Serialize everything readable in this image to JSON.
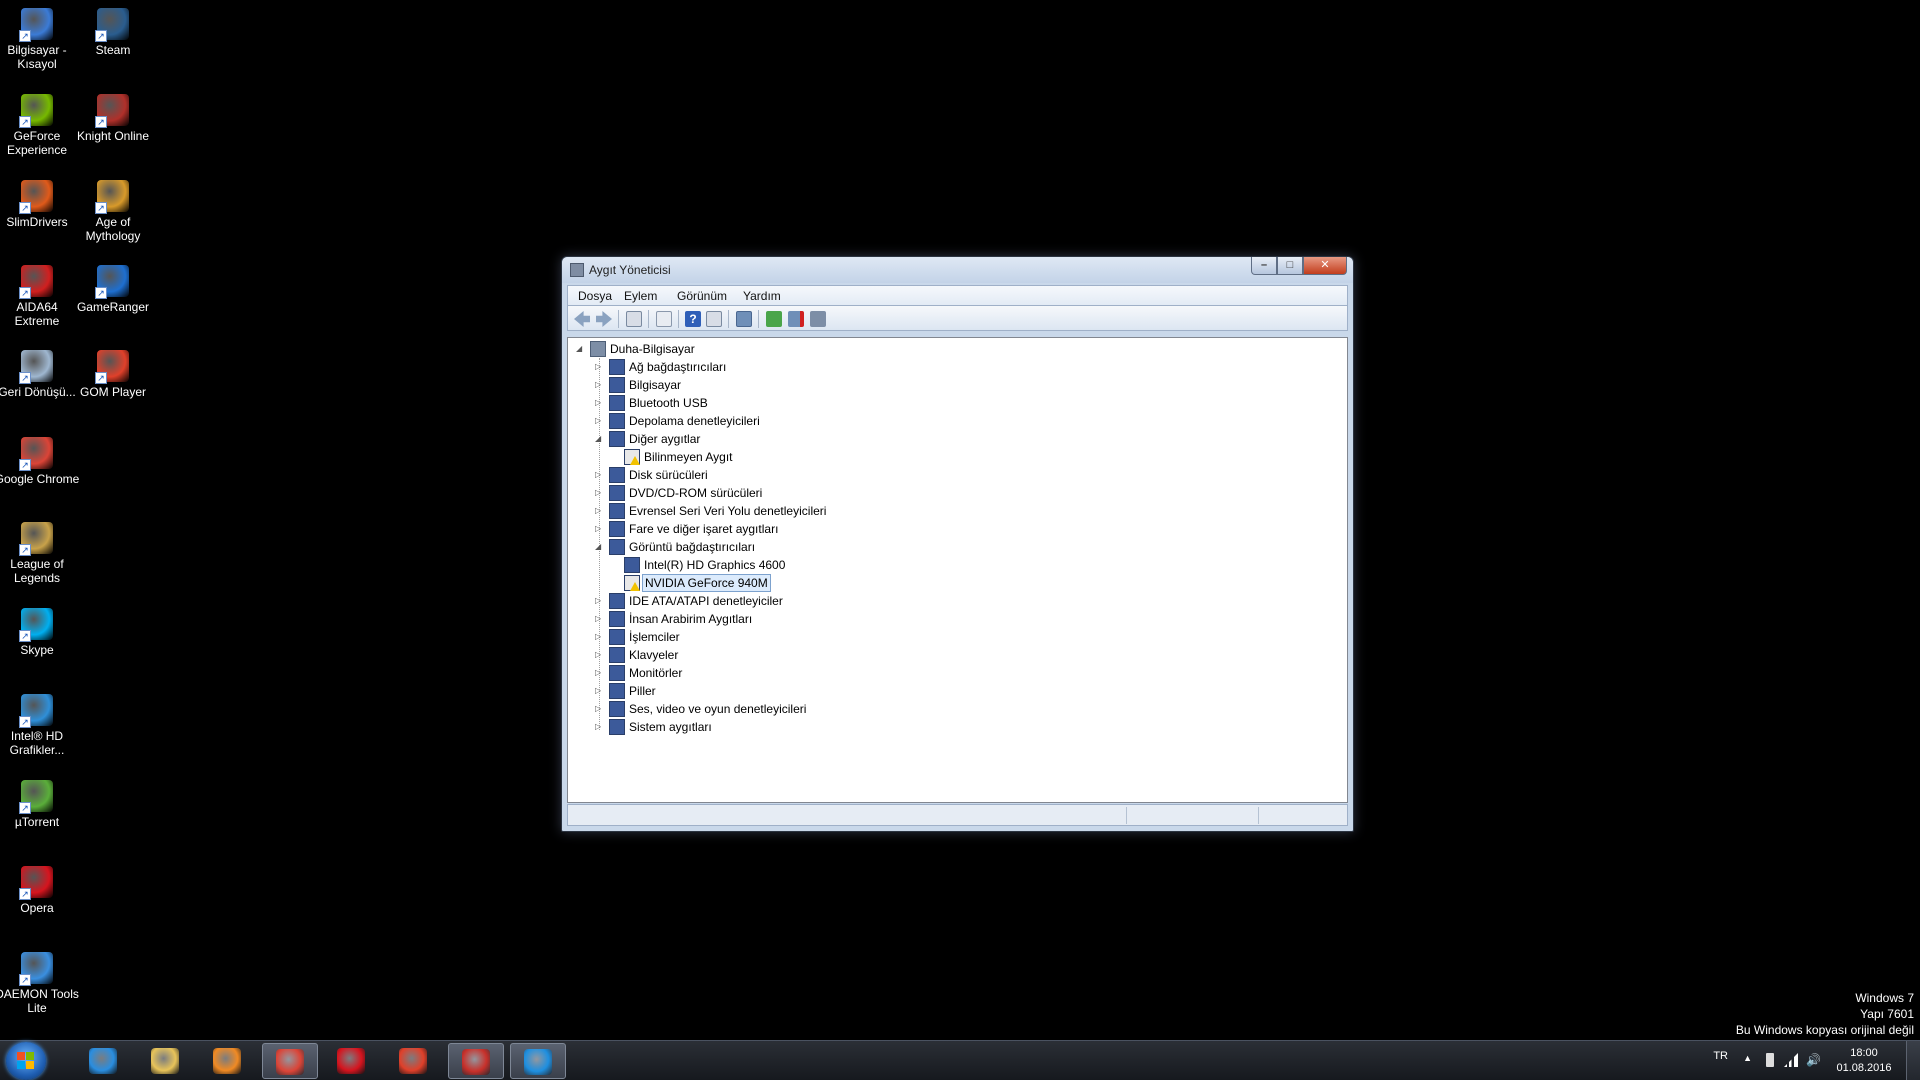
{
  "desktop_icons": [
    {
      "label": "Bilgisayar - Kısayol",
      "icon": "computer-icon",
      "color": "#3b7bd6"
    },
    {
      "label": "GeForce Experience",
      "icon": "geforce-icon",
      "color": "#76b900"
    },
    {
      "label": "SlimDrivers",
      "icon": "slimdrivers-icon",
      "color": "#e05a1a"
    },
    {
      "label": "AIDA64 Extreme",
      "icon": "aida64-icon",
      "color": "#d11f1f"
    },
    {
      "label": "Geri Dönüşü...",
      "icon": "recycle-bin-icon",
      "color": "#9fb7d0"
    },
    {
      "label": "Google Chrome",
      "icon": "chrome-icon",
      "color": "#db4437"
    },
    {
      "label": "League of Legends",
      "icon": "league-icon",
      "color": "#c8a24a"
    },
    {
      "label": "Skype",
      "icon": "skype-icon",
      "color": "#00aff0"
    },
    {
      "label": "Intel® HD Grafikler...",
      "icon": "intel-hd-icon",
      "color": "#2f8fd8"
    },
    {
      "label": "µTorrent",
      "icon": "utorrent-icon",
      "color": "#5aae3a"
    },
    {
      "label": "Opera",
      "icon": "opera-icon",
      "color": "#d6141e"
    },
    {
      "label": "DAEMON Tools Lite",
      "icon": "daemon-tools-icon",
      "color": "#3a8fe0"
    },
    {
      "label": "Steam",
      "icon": "steam-icon",
      "color": "#2a5d8f"
    },
    {
      "label": "Knight Online",
      "icon": "knight-online-icon",
      "color": "#b0302a"
    },
    {
      "label": "Age of Mythology",
      "icon": "age-of-mythology-icon",
      "color": "#d89a2a"
    },
    {
      "label": "GameRanger",
      "icon": "gameranger-icon",
      "color": "#1e6fd0"
    },
    {
      "label": "GOM Player",
      "icon": "gom-player-icon",
      "color": "#e0402a"
    }
  ],
  "watermark": {
    "line1": "Windows 7",
    "line2": "Yapı 7601",
    "line3": "Bu Windows kopyası orijinal değil"
  },
  "window": {
    "title": "Aygıt Yöneticisi",
    "menu": [
      "Dosya",
      "Eylem",
      "Görünüm",
      "Yardım"
    ],
    "tree_root": "Duha-Bilgisayar",
    "tree": [
      {
        "label": "Ağ bağdaştırıcıları",
        "icon": "network-adapter-icon",
        "expanded": false
      },
      {
        "label": "Bilgisayar",
        "icon": "computer-icon",
        "expanded": false
      },
      {
        "label": "Bluetooth USB",
        "icon": "bluetooth-icon",
        "expanded": false
      },
      {
        "label": "Depolama denetleyicileri",
        "icon": "storage-controller-icon",
        "expanded": false
      },
      {
        "label": "Diğer aygıtlar",
        "icon": "other-devices-icon",
        "expanded": true
      },
      {
        "label": "Bilinmeyen Aygıt",
        "icon": "unknown-device-warning-icon",
        "child": true,
        "warning": true
      },
      {
        "label": "Disk sürücüleri",
        "icon": "disk-drive-icon",
        "expanded": false
      },
      {
        "label": "DVD/CD-ROM sürücüleri",
        "icon": "dvd-drive-icon",
        "expanded": false
      },
      {
        "label": "Evrensel Seri Veri Yolu denetleyicileri",
        "icon": "usb-controller-icon",
        "expanded": false
      },
      {
        "label": "Fare ve diğer işaret aygıtları",
        "icon": "mouse-icon",
        "expanded": false
      },
      {
        "label": "Görüntü bağdaştırıcıları",
        "icon": "display-adapter-icon",
        "expanded": true
      },
      {
        "label": "Intel(R) HD Graphics 4600",
        "icon": "display-adapter-icon",
        "child": true
      },
      {
        "label": "NVIDIA GeForce 940M",
        "icon": "display-adapter-warning-icon",
        "child": true,
        "warning": true,
        "selected": true
      },
      {
        "label": "IDE ATA/ATAPI denetleyiciler",
        "icon": "ide-controller-icon",
        "expanded": false
      },
      {
        "label": "İnsan Arabirim Aygıtları",
        "icon": "hid-icon",
        "expanded": false
      },
      {
        "label": "İşlemciler",
        "icon": "processor-icon",
        "expanded": false
      },
      {
        "label": "Klavyeler",
        "icon": "keyboard-icon",
        "expanded": false
      },
      {
        "label": "Monitörler",
        "icon": "monitor-icon",
        "expanded": false
      },
      {
        "label": "Piller",
        "icon": "battery-icon",
        "expanded": false
      },
      {
        "label": "Ses, video ve oyun denetleyicileri",
        "icon": "audio-icon",
        "expanded": false
      },
      {
        "label": "Sistem aygıtları",
        "icon": "system-devices-icon",
        "expanded": false
      }
    ]
  },
  "taskbar": {
    "items": [
      {
        "icon": "internet-explorer-icon",
        "color": "#2a8ee0",
        "active": false
      },
      {
        "icon": "file-explorer-icon",
        "color": "#e8c45a",
        "active": false
      },
      {
        "icon": "media-player-icon",
        "color": "#f08a24",
        "active": false
      },
      {
        "icon": "chrome-icon",
        "color": "#db4437",
        "active": true
      },
      {
        "icon": "opera-icon",
        "color": "#d6141e",
        "active": false
      },
      {
        "icon": "gom-player-icon",
        "color": "#e0402a",
        "active": false
      },
      {
        "icon": "toolbox-icon",
        "color": "#c8302a",
        "active": true
      },
      {
        "icon": "device-manager-icon",
        "color": "#1e8fe0",
        "active": true
      }
    ],
    "language": "TR",
    "time": "18:00",
    "date": "01.08.2016"
  }
}
